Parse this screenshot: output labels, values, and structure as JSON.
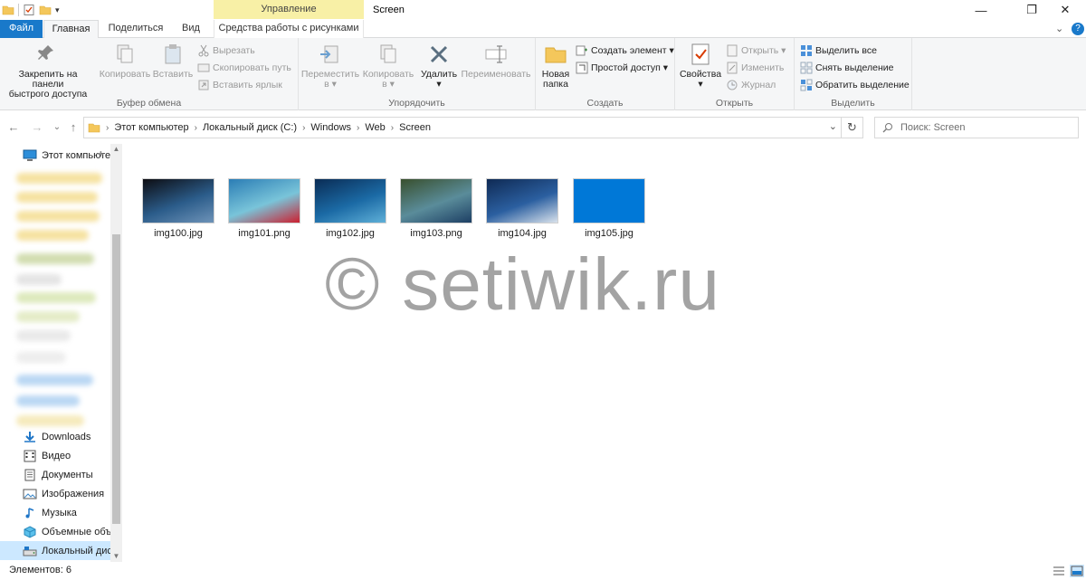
{
  "window": {
    "title": "Screen",
    "context_header": "Управление",
    "minimize_glyph": "—",
    "maximize_glyph": "❐",
    "close_glyph": "✕"
  },
  "tabs": {
    "file": "Файл",
    "home": "Главная",
    "share": "Поделиться",
    "view": "Вид",
    "picture_tools": "Средства работы с рисунками",
    "help_glyph": "?",
    "expand_glyph": "⌄"
  },
  "ribbon": {
    "clipboard": {
      "label": "Буфер обмена",
      "pin": "Закрепить на панели быстрого доступа",
      "pin_line1": "Закрепить на панели",
      "pin_line2": "быстрого доступа",
      "copy": "Копировать",
      "paste": "Вставить",
      "cut": "Вырезать",
      "copy_path": "Скопировать путь",
      "paste_shortcut": "Вставить ярлык"
    },
    "organize": {
      "label": "Упорядочить",
      "move_line1": "Переместить",
      "move_line2": "в ▾",
      "copy_line1": "Копировать",
      "copy_line2": "в ▾",
      "delete_line1": "Удалить",
      "delete_line2": "▾",
      "rename": "Переименовать"
    },
    "create": {
      "label": "Создать",
      "new_folder_line1": "Новая",
      "new_folder_line2": "папка",
      "new_item": "Создать элемент ▾",
      "easy_access": "Простой доступ ▾"
    },
    "open": {
      "label": "Открыть",
      "properties_line1": "Свойства",
      "properties_line2": "▾",
      "open": "Открыть ▾",
      "edit": "Изменить",
      "history": "Журнал"
    },
    "select": {
      "label": "Выделить",
      "select_all": "Выделить все",
      "select_none": "Снять выделение",
      "invert": "Обратить выделение"
    }
  },
  "nav": {
    "back": "←",
    "forward": "→",
    "recent": "⌄",
    "up": "↑",
    "breadcrumb": [
      "Этот компьютер",
      "Локальный диск (C:)",
      "Windows",
      "Web",
      "Screen"
    ],
    "crumb_sep": "›",
    "dropdown": "⌄",
    "refresh": "↻",
    "search_placeholder": "Поиск: Screen"
  },
  "sidebar": {
    "items": [
      {
        "label": "Этот компьютер",
        "icon": "computer-icon"
      },
      {
        "label": "Downloads",
        "icon": "download-icon"
      },
      {
        "label": "Видео",
        "icon": "video-icon"
      },
      {
        "label": "Документы",
        "icon": "documents-icon"
      },
      {
        "label": "Изображения",
        "icon": "pictures-icon"
      },
      {
        "label": "Музыка",
        "icon": "music-icon"
      },
      {
        "label": "Объемные объекты",
        "icon": "3d-objects-icon"
      },
      {
        "label": "Локальный диск (C:)",
        "icon": "drive-icon"
      }
    ],
    "pin_glyph": "📌"
  },
  "files": [
    {
      "name": "img100.jpg",
      "colors": [
        "#0d0d12",
        "#2b5c8a",
        "#6e93b8"
      ]
    },
    {
      "name": "img101.png",
      "colors": [
        "#2b7db5",
        "#79c4d9",
        "#cc2030"
      ]
    },
    {
      "name": "img102.jpg",
      "colors": [
        "#0a2c55",
        "#1b6aa5",
        "#5fb0d8"
      ]
    },
    {
      "name": "img103.png",
      "colors": [
        "#39502e",
        "#5a8c9a",
        "#1d3f64"
      ]
    },
    {
      "name": "img104.jpg",
      "colors": [
        "#0f2a54",
        "#2b5fa0",
        "#d9e2ec"
      ]
    },
    {
      "name": "img105.jpg",
      "colors": [
        "#0078d7",
        "#0078d7",
        "#0078d7"
      ]
    }
  ],
  "watermark": "© setiwik.ru",
  "status": {
    "items_count": "Элементов: 6"
  },
  "colors": {
    "accent": "#1979ca",
    "context_tab": "#f8f0a6",
    "selection": "#cce8ff"
  }
}
